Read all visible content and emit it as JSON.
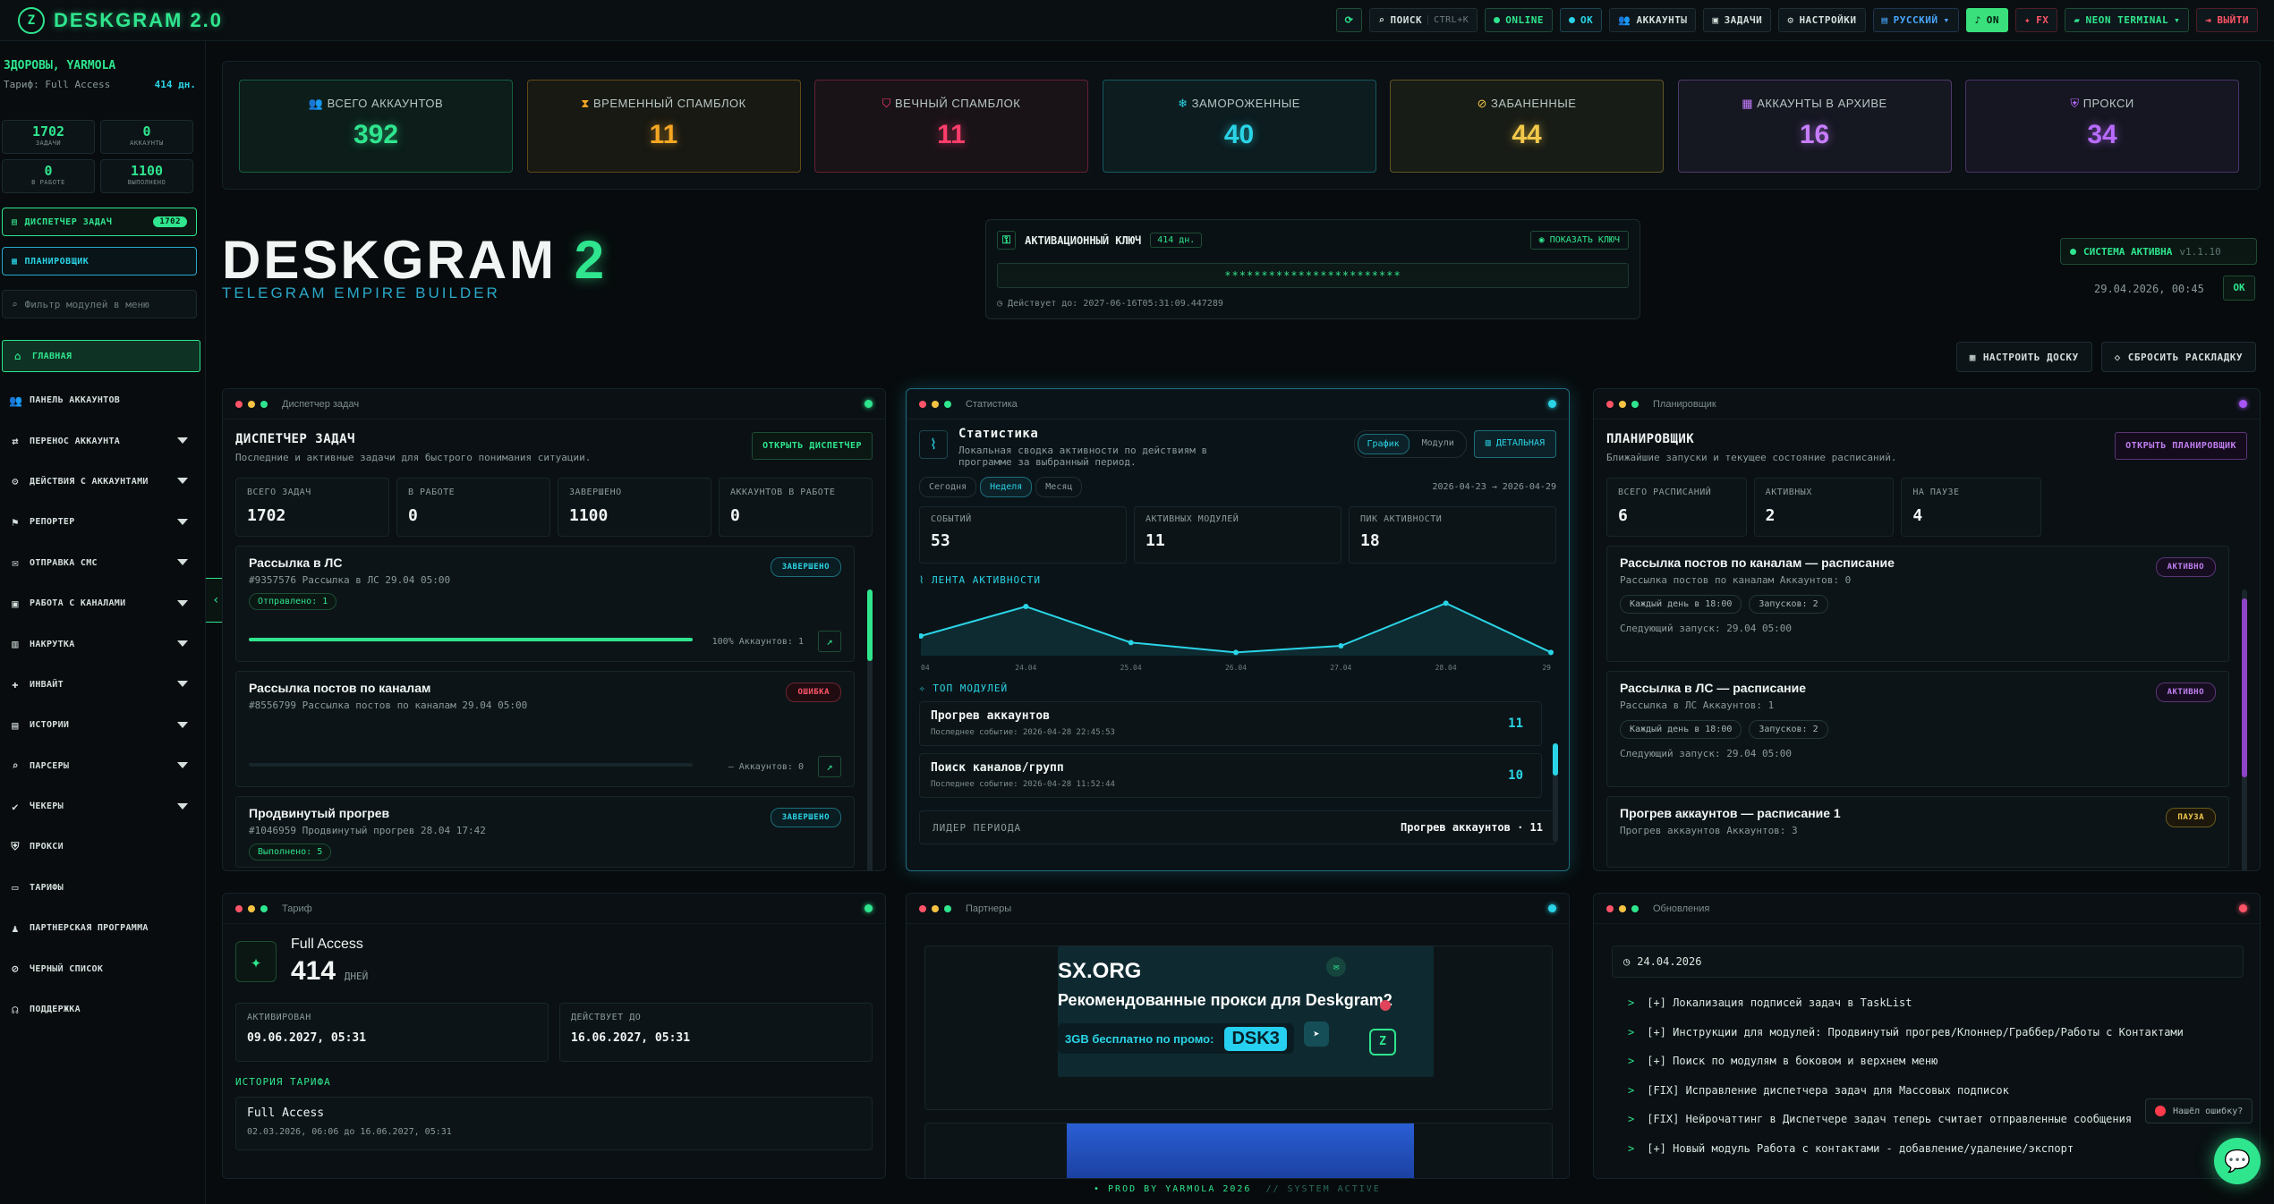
{
  "app": {
    "logo_text": "DESKGRAM 2.0"
  },
  "topbar": {
    "refresh_icon": "refresh-icon",
    "search_label": "ПОИСК",
    "search_hint": "CTRL+K",
    "online_label": "ONLINE",
    "ok_label": "OK",
    "accounts_label": "АККАУНТЫ",
    "tasks_label": "ЗАДАЧИ",
    "settings_label": "НАСТРОЙКИ",
    "language_label": "РУССКИЙ",
    "on_label": "ON",
    "fx_label": "FX",
    "theme_label": "NEON TERMINAL",
    "logout_label": "ВЫЙТИ"
  },
  "sidebar": {
    "greeting": "ЗДОРОВЫ, YARMOLA",
    "tariff_label": "Тариф: Full Access",
    "tariff_days": "414 дн.",
    "mini_stats": [
      {
        "value": "1702",
        "label": "задачи"
      },
      {
        "value": "0",
        "label": "аккаунты"
      },
      {
        "value": "0",
        "label": "в работе"
      },
      {
        "value": "1100",
        "label": "выполнено"
      }
    ],
    "dispatcher_label": "ДИСПЕТЧЕР ЗАДАЧ",
    "dispatcher_badge": "1702",
    "planner_label": "ПЛАНИРОВЩИК",
    "filter_placeholder": "Фильтр модулей в меню",
    "nav": [
      {
        "label": "ГЛАВНАЯ",
        "icon": "home-icon",
        "caret": false,
        "active": true
      },
      {
        "label": "ПАНЕЛЬ АККАУНТОВ",
        "icon": "users-icon",
        "caret": false
      },
      {
        "label": "ПЕРЕНОС АККАУНТА",
        "icon": "user-transfer-icon",
        "caret": true
      },
      {
        "label": "ДЕЙСТВИЯ С АККАУНТАМИ",
        "icon": "user-gear-icon",
        "caret": true
      },
      {
        "label": "РЕПОРТЕР",
        "icon": "flag-icon",
        "caret": true
      },
      {
        "label": "ОТПРАВКА СМС",
        "icon": "chat-icon",
        "caret": true
      },
      {
        "label": "РАБОТА С КАНАЛАМИ",
        "icon": "briefcase-icon",
        "caret": true
      },
      {
        "label": "НАКРУТКА",
        "icon": "chart-icon",
        "caret": true
      },
      {
        "label": "ИНВАЙТ",
        "icon": "user-plus-icon",
        "caret": true
      },
      {
        "label": "ИСТОРИИ",
        "icon": "stories-icon",
        "caret": true
      },
      {
        "label": "ПАРСЕРЫ",
        "icon": "search-icon",
        "caret": true
      },
      {
        "label": "ЧЕКЕРЫ",
        "icon": "check-icon",
        "caret": true
      },
      {
        "label": "ПРОКСИ",
        "icon": "shield-icon",
        "caret": false
      },
      {
        "label": "ТАРИФЫ",
        "icon": "card-icon",
        "caret": false
      },
      {
        "label": "ПАРТНЕРСКАЯ ПРОГРАММА",
        "icon": "partners-icon",
        "caret": false
      },
      {
        "label": "ЧЕРНЫЙ СПИСОК",
        "icon": "user-block-icon",
        "caret": false
      },
      {
        "label": "ПОДДЕРЖКА",
        "icon": "headset-icon",
        "caret": false
      }
    ]
  },
  "stats": [
    {
      "label": "ВСЕГО АККАУНТОВ",
      "value": "392",
      "color": "#2fe58e",
      "icon": "users-icon"
    },
    {
      "label": "ВРЕМЕННЫЙ СПАМБЛОК",
      "value": "11",
      "color": "#f5a623",
      "icon": "hourglass-icon"
    },
    {
      "label": "ВЕЧНЫЙ СПАМБЛОК",
      "value": "11",
      "color": "#ff3d6b",
      "icon": "shield-alert-icon"
    },
    {
      "label": "ЗАМОРОЖЕННЫЕ",
      "value": "40",
      "color": "#2ad4e6",
      "icon": "snowflake-icon"
    },
    {
      "label": "ЗАБАНЕННЫЕ",
      "value": "44",
      "color": "#f1c84a",
      "icon": "ban-icon"
    },
    {
      "label": "АККАУНТЫ В АРХИВЕ",
      "value": "16",
      "color": "#c77dff",
      "icon": "archive-icon"
    },
    {
      "label": "ПРОКСИ",
      "value": "34",
      "color": "#b86bff",
      "icon": "shield-icon"
    }
  ],
  "hero": {
    "title_main": "DESKGRAM",
    "title_accent": "2",
    "subtitle": "TELEGRAM EMPIRE BUILDER"
  },
  "activation": {
    "title": "АКТИВАЦИОННЫЙ КЛЮЧ",
    "days_badge": "414 дн.",
    "show_key_label": "ПОКАЗАТЬ КЛЮЧ",
    "masked_key": "************************",
    "valid_until": "Действует до: 2027-06-16T05:31:09.447289"
  },
  "system": {
    "status": "СИСТЕМА АКТИВНА",
    "version": "v1.1.10",
    "datetime": "29.04.2026, 00:45",
    "ok": "OK"
  },
  "board": {
    "configure_label": "НАСТРОИТЬ ДОСКУ",
    "reset_label": "СБРОСИТЬ РАСКЛАДКУ"
  },
  "dispatcher": {
    "bar_title": "Диспетчер задач",
    "title": "ДИСПЕТЧЕР ЗАДАЧ",
    "desc": "Последние и активные задачи для быстрого понимания ситуации.",
    "open_label": "ОТКРЫТЬ ДИСПЕТЧЕР",
    "metrics": [
      {
        "label": "ВСЕГО ЗАДАЧ",
        "value": "1702"
      },
      {
        "label": "В РАБОТЕ",
        "value": "0"
      },
      {
        "label": "ЗАВЕРШЕНО",
        "value": "1100"
      },
      {
        "label": "АККАУНТОВ В РАБОТЕ",
        "value": "0"
      }
    ],
    "tasks": [
      {
        "title": "Рассылка в ЛС",
        "meta": "#9357576  Рассылка в ЛС 29.04 05:00",
        "pill": "Отправлено: 1",
        "status": "ЗАВЕРШЕНО",
        "progress": 100,
        "pinfo": "100%  Аккаунтов: 1"
      },
      {
        "title": "Рассылка постов по каналам",
        "meta": "#8556799  Рассылка постов по каналам 29.04 05:00",
        "pill": "",
        "status": "ОШИБКА",
        "progress": 0,
        "pinfo": "—  Аккаунтов: 0"
      },
      {
        "title": "Продвинутый прогрев",
        "meta": "#1046959  Продвинутый прогрев 28.04 17:42",
        "pill": "Выполнено: 5",
        "status": "ЗАВЕРШЕНО"
      }
    ]
  },
  "statistics": {
    "bar_title": "Статистика",
    "title": "Статистика",
    "desc": "Локальная сводка активности по действиям в программе за выбранный период.",
    "view_chart": "График",
    "view_modules": "Модули",
    "detail_label": "ДЕТАЛЬНАЯ",
    "periods": [
      "Сегодня",
      "Неделя",
      "Месяц"
    ],
    "range": "2026-04-23 → 2026-04-29",
    "metrics": [
      {
        "label": "СОБЫТИЙ",
        "value": "53"
      },
      {
        "label": "АКТИВНЫХ МОДУЛЕЙ",
        "value": "11"
      },
      {
        "label": "ПИК АКТИВНОСТИ",
        "value": "18"
      }
    ],
    "feed_title": "ЛЕНТА АКТИВНОСТИ",
    "top_title": "ТОП МОДУЛЕЙ",
    "modules": [
      {
        "name": "Прогрев аккаунтов",
        "last": "Последнее событие: 2026-04-28 22:45:53",
        "count": "11"
      },
      {
        "name": "Поиск каналов/групп",
        "last": "Последнее событие: 2026-04-28 11:52:44",
        "count": "10"
      }
    ],
    "leader_label": "ЛИДЕР ПЕРИОДА",
    "leader_value": "Прогрев аккаунтов · 11"
  },
  "chart_data": {
    "type": "area",
    "title": "ЛЕНТА АКТИВНОСТИ",
    "x": [
      "04",
      "24.04",
      "25.04",
      "26.04",
      "27.04",
      "28.04",
      "29"
    ],
    "values": [
      6,
      15,
      4,
      1,
      3,
      16,
      1
    ],
    "ylim": [
      0,
      18
    ],
    "color": "#2ad4e6",
    "grid": false
  },
  "planner": {
    "bar_title": "Планировщик",
    "title": "ПЛАНИРОВЩИК",
    "desc": "Ближайшие запуски и текущее состояние расписаний.",
    "open_label": "ОТКРЫТЬ ПЛАНИРОВЩИК",
    "metrics": [
      {
        "label": "ВСЕГО РАСПИСАНИЙ",
        "value": "6"
      },
      {
        "label": "АКТИВНЫХ",
        "value": "2"
      },
      {
        "label": "НА ПАУЗЕ",
        "value": "4"
      }
    ],
    "items": [
      {
        "title": "Рассылка постов по каналам — расписание",
        "meta": "Рассылка постов по каналам  Аккаунтов: 0",
        "chip1": "Каждый день в 18:00",
        "chip2": "Запусков: 2",
        "next": "Следующий запуск: 29.04 05:00",
        "status": "АКТИВНО"
      },
      {
        "title": "Рассылка в ЛС — расписание",
        "meta": "Рассылка в ЛС  Аккаунтов: 1",
        "chip1": "Каждый день в 18:00",
        "chip2": "Запусков: 2",
        "next": "Следующий запуск: 29.04 05:00",
        "status": "АКТИВНО"
      },
      {
        "title": "Прогрев аккаунтов — расписание 1",
        "meta": "Прогрев аккаунтов  Аккаунтов: 3",
        "status": "ПАУЗА"
      }
    ]
  },
  "tariff": {
    "bar_title": "Тариф",
    "name": "Full Access",
    "days": "414",
    "days_unit": "ДНЕЙ",
    "activated_label": "АКТИВИРОВАН",
    "activated_value": "09.06.2027, 05:31",
    "valid_label": "ДЕЙСТВУЕТ ДО",
    "valid_value": "16.06.2027, 05:31",
    "history_title": "ИСТОРИЯ ТАРИФА",
    "history": [
      {
        "name": "Full Access",
        "range": "02.03.2026, 06:06 до 16.06.2027, 05:31"
      }
    ]
  },
  "partners": {
    "bar_title": "Партнеры",
    "brand": "SX.ORG",
    "headline": "Рекомендованные прокси для Deskgram2",
    "promo_text": "3GB бесплатно по промо:",
    "promo_code": "DSK3"
  },
  "updates": {
    "bar_title": "Обновления",
    "date": "24.04.2026",
    "lines": [
      "[+] Локализация подписей задач в TaskList",
      "[+] Инструкции для модулей: Продвинутый прогрев/Клоннер/Граббер/Работы с Контактами",
      "[+] Поиск по модулям в боковом и верхнем меню",
      "[FIX] Исправление диспетчера задач для Массовых подписок",
      "[FIX] Нейрочаттинг в Диспетчере задач теперь считает отправленные сообщения",
      "[+] Новый модуль Работа с контактами - добавление/удаление/экспорт"
    ]
  },
  "footer": {
    "text": "• PROD BY YARMOLA 2026",
    "sys": "// SYSTEM ACTIVE"
  },
  "misc": {
    "bug_label": "Нашёл ошибку?"
  }
}
